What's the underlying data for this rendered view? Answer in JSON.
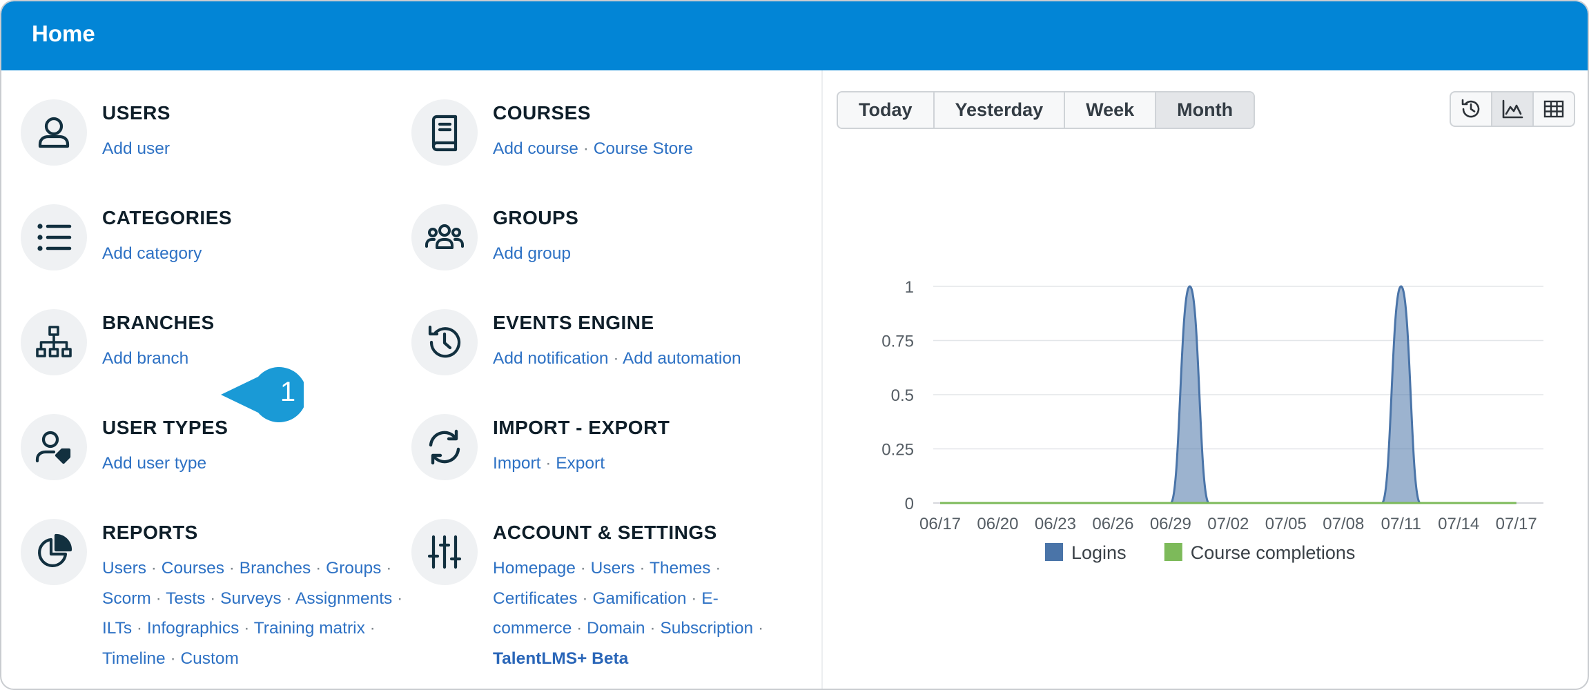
{
  "header": {
    "title": "Home"
  },
  "cards": {
    "users": {
      "title": "USERS",
      "links": [
        "Add user"
      ]
    },
    "courses": {
      "title": "COURSES",
      "links": [
        "Add course",
        "Course Store"
      ]
    },
    "categories": {
      "title": "CATEGORIES",
      "links": [
        "Add category"
      ]
    },
    "groups": {
      "title": "GROUPS",
      "links": [
        "Add group"
      ]
    },
    "branches": {
      "title": "BRANCHES",
      "links": [
        "Add branch"
      ]
    },
    "events_engine": {
      "title": "EVENTS ENGINE",
      "links": [
        "Add notification",
        "Add automation"
      ]
    },
    "user_types": {
      "title": "USER TYPES",
      "links": [
        "Add user type"
      ]
    },
    "import_export": {
      "title": "IMPORT - EXPORT",
      "links": [
        "Import",
        "Export"
      ]
    },
    "reports": {
      "title": "REPORTS",
      "links": [
        "Users",
        "Courses",
        "Branches",
        "Groups",
        "Scorm",
        "Tests",
        "Surveys",
        "Assignments",
        "ILTs",
        "Infographics",
        "Training matrix",
        "Timeline",
        "Custom"
      ]
    },
    "account_settings": {
      "title": "ACCOUNT & SETTINGS",
      "links": [
        "Homepage",
        "Users",
        "Themes",
        "Certificates",
        "Gamification",
        "E-commerce",
        "Domain",
        "Subscription"
      ],
      "special_link": "TalentLMS+ Beta"
    }
  },
  "callout": {
    "number": "1",
    "color": "#1a9ad6"
  },
  "period_tabs": {
    "items": [
      "Today",
      "Yesterday",
      "Week",
      "Month"
    ],
    "active": "Month"
  },
  "view_toggle": {
    "items": [
      "history-icon",
      "area-chart-icon",
      "table-grid-icon"
    ],
    "active": "area-chart-icon"
  },
  "colors": {
    "accent": "#0285d6",
    "link": "#2d71c4",
    "logins": "#4a74a8",
    "completions": "#7dba5a"
  },
  "chart_data": {
    "type": "area",
    "x": [
      "06/17",
      "06/18",
      "06/19",
      "06/20",
      "06/21",
      "06/22",
      "06/23",
      "06/24",
      "06/25",
      "06/26",
      "06/27",
      "06/28",
      "06/29",
      "06/30",
      "07/01",
      "07/02",
      "07/03",
      "07/04",
      "07/05",
      "07/06",
      "07/07",
      "07/08",
      "07/09",
      "07/10",
      "07/11",
      "07/12",
      "07/13",
      "07/14",
      "07/15",
      "07/16",
      "07/17"
    ],
    "tick_labels": [
      "06/17",
      "06/20",
      "06/23",
      "06/26",
      "06/29",
      "07/02",
      "07/05",
      "07/08",
      "07/11",
      "07/14",
      "07/17"
    ],
    "series": [
      {
        "name": "Logins",
        "color": "#4a74a8",
        "values": [
          0,
          0,
          0,
          0,
          0,
          0,
          0,
          0,
          0,
          0,
          0,
          0,
          0,
          1,
          0,
          0,
          0,
          0,
          0,
          0,
          0,
          0,
          0,
          0,
          1,
          0,
          0,
          0,
          0,
          0,
          0
        ]
      },
      {
        "name": "Course completions",
        "color": "#7dba5a",
        "values": [
          0,
          0,
          0,
          0,
          0,
          0,
          0,
          0,
          0,
          0,
          0,
          0,
          0,
          0,
          0,
          0,
          0,
          0,
          0,
          0,
          0,
          0,
          0,
          0,
          0,
          0,
          0,
          0,
          0,
          0,
          0
        ]
      }
    ],
    "y_ticks": [
      "0",
      "0.25",
      "0.5",
      "0.75",
      "1"
    ],
    "ylim": [
      0,
      1
    ],
    "grid": true,
    "legend_position": "bottom-center"
  }
}
